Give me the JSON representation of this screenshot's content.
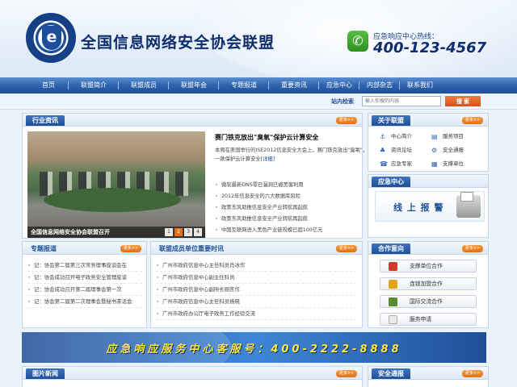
{
  "header": {
    "site_title": "全国信息网络安全协会联盟",
    "hotline_label": "应急响应中心热线：",
    "hotline_number": "400-123-4567"
  },
  "nav": {
    "items": [
      "首页",
      "联盟简介",
      "联盟成员",
      "联盟年会",
      "专题报道",
      "重要资讯",
      "应急中心",
      "内部杂志",
      "联系我们"
    ]
  },
  "search": {
    "label": "站内检索",
    "placeholder": "输入你搜的内容",
    "button": "搜 索"
  },
  "more_label": "更多>>",
  "industry": {
    "title": "行业资讯",
    "photo_caption": "全国信息网络安全协会联盟召开",
    "pager": [
      "1",
      "2",
      "3",
      "4"
    ],
    "active_page": "2",
    "headline": "赛门铁克放出\"臭氧\"保护云计算安全",
    "summary": "本周在美国举行的ISE2012信息安全大会上，赛门铁克放出\"臭氧\"，这是一款保护云计算安全",
    "summary_link": "[详细]",
    "items": [
      "微软最新DNS零日漏洞已被黑客利用",
      "2012年信息安全的六大数据库风险",
      "政策东风助推信息安全产业转航再起航",
      "政策东风助推信息安全产业转航再起航",
      "中国互联网进入黑色产业链规模已超100亿元"
    ]
  },
  "about": {
    "title": "关于联盟",
    "links": [
      {
        "icon": "⚓",
        "label": "中心简介"
      },
      {
        "icon": "▤",
        "label": "服务项目"
      },
      {
        "icon": "♣",
        "label": "资讯论坛"
      },
      {
        "icon": "⚙",
        "label": "安全通报"
      },
      {
        "icon": "☎",
        "label": "应急专家"
      },
      {
        "icon": "▦",
        "label": "支撑单位"
      }
    ]
  },
  "emergency": {
    "title": "应急中心",
    "box_text": "线 上 报 警"
  },
  "special": {
    "title": "专题报道",
    "items": [
      "记：协会第二届第三次常务理事座谈会在",
      "记：协会成功召开电子政务安全管理座谈",
      "记：协会成功召开第二届理事会第一次",
      "记：协会第二届第二次理事会暨秘书茶话会"
    ]
  },
  "members": {
    "title": "联盟成员单位重要时讯",
    "items": [
      "广州市政府信息中心主任科员肖冰作",
      "广州市政府信息中心副主任科员",
      "广州市政府信息中心副所长刚东作",
      "广州市政府信息中心主任科员杨晓",
      "广州市政府办公厅电子政务工作经验交流"
    ]
  },
  "cooperation": {
    "title": "合作意向",
    "buttons": [
      {
        "label": "支撑单位合作",
        "color": "#d23a2c"
      },
      {
        "label": "连锁加盟合作",
        "color": "#e3a21a"
      },
      {
        "label": "国际交流合作",
        "color": "#5a8a2e"
      },
      {
        "label": "服务申请",
        "color": "#e9e9e9"
      }
    ]
  },
  "banner": {
    "text": "应急响应服务中心客服号：400-2222-8888"
  },
  "photo_news": {
    "title": "图片新闻"
  },
  "security_notice": {
    "title": "安全通报"
  }
}
